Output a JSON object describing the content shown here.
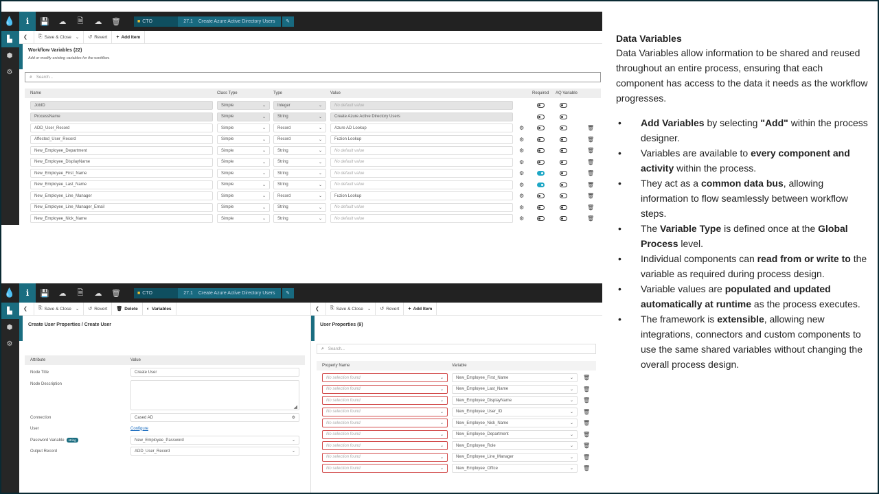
{
  "crumb": {
    "folder": "CTO",
    "id": "27.1",
    "name": "Create Azure Active Directory Users"
  },
  "toolbar": {
    "save_close": "Save & Close",
    "revert": "Revert",
    "add_item": "Add Item",
    "delete": "Delete",
    "variables": "Variables"
  },
  "workflow": {
    "title": "Workflow Variables (22)",
    "subtitle": "Add or modify existing variables for the workflow.",
    "search_placeholder": "Search...",
    "columns": {
      "name": "Name",
      "class_type": "Class Type",
      "type": "Type",
      "value": "Value",
      "required": "Required",
      "aq": "AQ Variable"
    },
    "rows": [
      {
        "name": "JobID",
        "class": "Simple",
        "type": "Integer",
        "value": "No default value",
        "ro": true,
        "ph": true,
        "gear": false,
        "trash": false,
        "req": false,
        "aq": false
      },
      {
        "name": "ProcessName",
        "class": "Simple",
        "type": "String",
        "value": "Create Azure Active Directory Users",
        "ro": true,
        "ph": false,
        "gear": false,
        "trash": false,
        "req": false,
        "aq": false
      },
      {
        "name": "ADD_User_Record",
        "class": "Simple",
        "type": "Record",
        "value": "Azure AD Lookup",
        "ro": false,
        "ph": false,
        "gear": true,
        "trash": true,
        "req": false,
        "aq": false
      },
      {
        "name": "Affected_User_Record",
        "class": "Simple",
        "type": "Record",
        "value": "Fuzion Lookup",
        "ro": false,
        "ph": false,
        "gear": true,
        "trash": true,
        "req": false,
        "aq": false
      },
      {
        "name": "New_Employee_Department",
        "class": "Simple",
        "type": "String",
        "value": "No default value",
        "ro": false,
        "ph": true,
        "gear": true,
        "trash": true,
        "req": false,
        "aq": false
      },
      {
        "name": "New_Employee_DisplayName",
        "class": "Simple",
        "type": "String",
        "value": "No default value",
        "ro": false,
        "ph": true,
        "gear": true,
        "trash": true,
        "req": false,
        "aq": false
      },
      {
        "name": "New_Employee_First_Name",
        "class": "Simple",
        "type": "String",
        "value": "No default value",
        "ro": false,
        "ph": true,
        "gear": true,
        "trash": true,
        "req": true,
        "aq": false
      },
      {
        "name": "New_Employee_Last_Name",
        "class": "Simple",
        "type": "String",
        "value": "No default value",
        "ro": false,
        "ph": true,
        "gear": true,
        "trash": true,
        "req": true,
        "aq": false
      },
      {
        "name": "New_Employee_Line_Manager",
        "class": "Simple",
        "type": "Record",
        "value": "Fuzion Lookup",
        "ro": false,
        "ph": false,
        "gear": true,
        "trash": true,
        "req": false,
        "aq": false
      },
      {
        "name": "New_Employee_Line_Manager_Email",
        "class": "Simple",
        "type": "String",
        "value": "No default value",
        "ro": false,
        "ph": true,
        "gear": true,
        "trash": true,
        "req": false,
        "aq": false
      },
      {
        "name": "New_Employee_Nick_Name",
        "class": "Simple",
        "type": "String",
        "value": "No default value",
        "ro": false,
        "ph": true,
        "gear": true,
        "trash": true,
        "req": false,
        "aq": false
      }
    ]
  },
  "node": {
    "title": "Create User Properties / Create User",
    "columns": {
      "attribute": "Attribute",
      "value": "Value"
    },
    "node_title_label": "Node Title",
    "node_title_value": "Create User",
    "node_desc_label": "Node Description",
    "connection_label": "Connection",
    "connection_value": "Cased AD",
    "user_label": "User",
    "user_value": "Configure",
    "password_label": "Password Variable",
    "password_tag": "string",
    "password_value": "New_Employee_Password",
    "output_label": "Output Record",
    "output_value": "ADD_User_Record"
  },
  "userprops": {
    "title": "User Properties (9)",
    "search_placeholder": "Search...",
    "columns": {
      "property": "Property Name",
      "variable": "Variable"
    },
    "rows": [
      {
        "property": "No selection found",
        "variable": "New_Employee_First_Name"
      },
      {
        "property": "No selection found",
        "variable": "New_Employee_Last_Name"
      },
      {
        "property": "No selection found",
        "variable": "New_Employee_DisplayName"
      },
      {
        "property": "No selection found",
        "variable": "New_Employee_User_ID"
      },
      {
        "property": "No selection found",
        "variable": "New_Employee_Nick_Name"
      },
      {
        "property": "No selection found",
        "variable": "New_Employee_Department"
      },
      {
        "property": "No selection found",
        "variable": "New_Employee_Role"
      },
      {
        "property": "No selection found",
        "variable": "New_Employee_Line_Manager"
      },
      {
        "property": "No selection found",
        "variable": "New_Employee_Office"
      }
    ]
  },
  "desc": {
    "title": "Data Variables",
    "intro": "Data Variables allow information to be shared and reused throughout an entire process, ensuring that each component has access to the data it needs as the workflow progresses.",
    "b1a": "Add Variables",
    "b1b": " by selecting ",
    "b1c": "\"Add\"",
    "b1d": " within the process designer.",
    "b2a": "Variables are available to ",
    "b2b": "every component and activity",
    "b2c": " within the process.",
    "b3a": "They act as a ",
    "b3b": "common data bus",
    "b3c": ", allowing information to flow seamlessly between workflow steps.",
    "b4a": "The ",
    "b4b": "Variable Type",
    "b4c": " is defined once at the ",
    "b4d": "Global Process",
    "b4e": " level.",
    "b5a": "Individual components can ",
    "b5b": "read from or write to",
    "b5c": " the variable as required during process design.",
    "b6a": "Variable values are ",
    "b6b": "populated and updated automatically at runtime",
    "b6c": " as the process executes.",
    "b7a": "The framework is ",
    "b7b": "extensible",
    "b7c": ", allowing new integrations, connectors and custom components to use the same shared variables without changing the overall process design."
  }
}
